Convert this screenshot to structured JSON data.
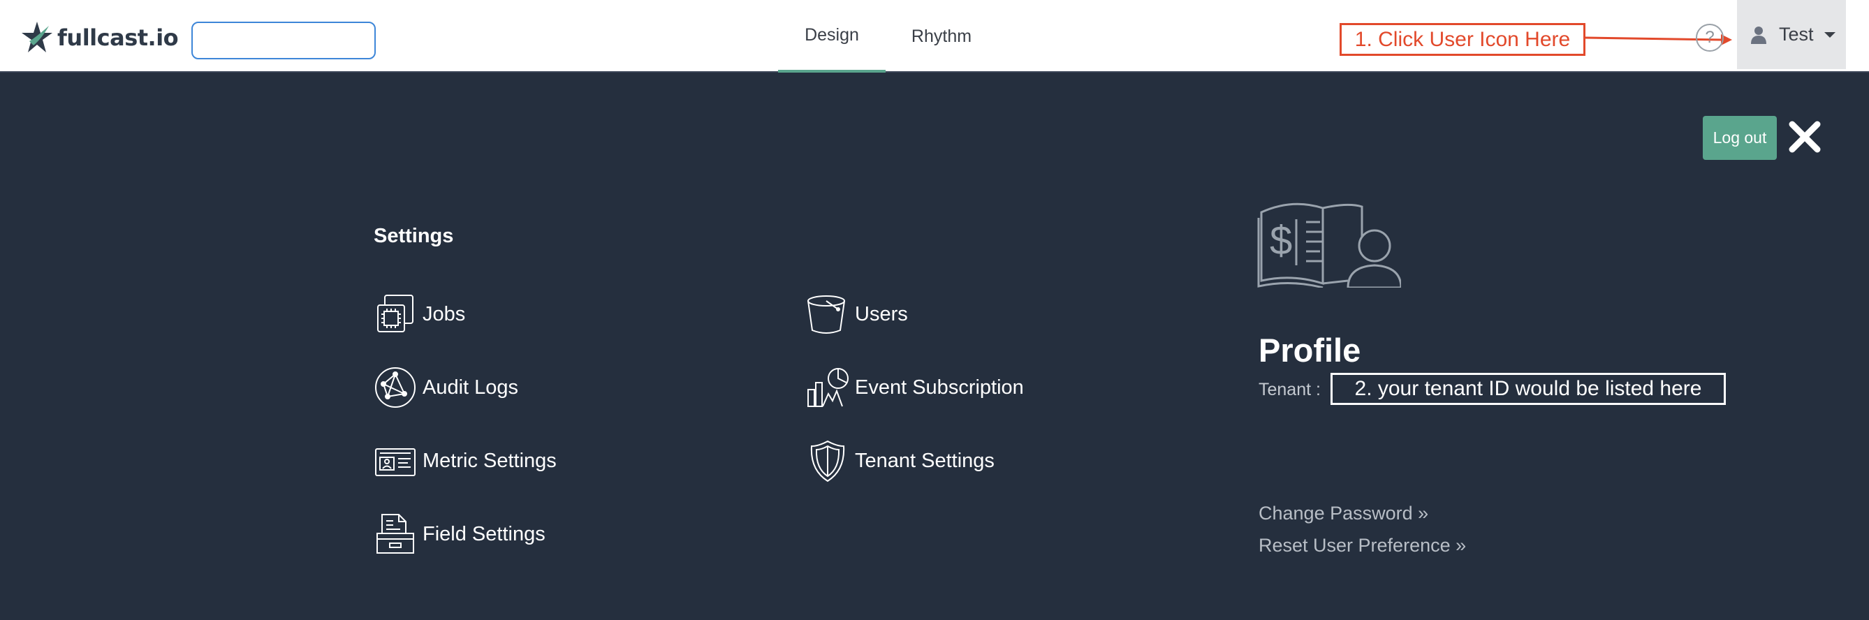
{
  "header": {
    "logo_text": "fullcast.io",
    "search": {
      "value": "",
      "placeholder": ""
    },
    "tabs": [
      {
        "label": "Design",
        "active": true
      },
      {
        "label": "Rhythm",
        "active": false
      }
    ],
    "help_label": "?",
    "user": {
      "name": "Test",
      "icon": "user-icon"
    }
  },
  "annotations": {
    "step1": "1. Click User Icon Here",
    "step2": "2. your tenant ID would be listed here"
  },
  "panel": {
    "logout_label": "Log out",
    "close_icon": "close-icon",
    "settings": {
      "title": "Settings",
      "items": [
        {
          "label": "Jobs",
          "icon": "chip-icon"
        },
        {
          "label": "Users",
          "icon": "bucket-icon"
        },
        {
          "label": "Audit Logs",
          "icon": "globe-network-icon"
        },
        {
          "label": "Event Subscription",
          "icon": "analytics-icon"
        },
        {
          "label": "Metric Settings",
          "icon": "id-card-icon"
        },
        {
          "label": "Tenant Settings",
          "icon": "shield-icon"
        },
        {
          "label": "Field Settings",
          "icon": "file-cabinet-icon"
        }
      ]
    },
    "profile": {
      "title": "Profile",
      "tenant_label": "Tenant :",
      "links": [
        {
          "label": "Change Password »"
        },
        {
          "label": "Reset User Preference »"
        }
      ]
    }
  },
  "colors": {
    "panel_bg": "#252f3e",
    "accent": "#5aa58d",
    "annotation": "#e2492b",
    "search_border": "#3d86d8"
  }
}
